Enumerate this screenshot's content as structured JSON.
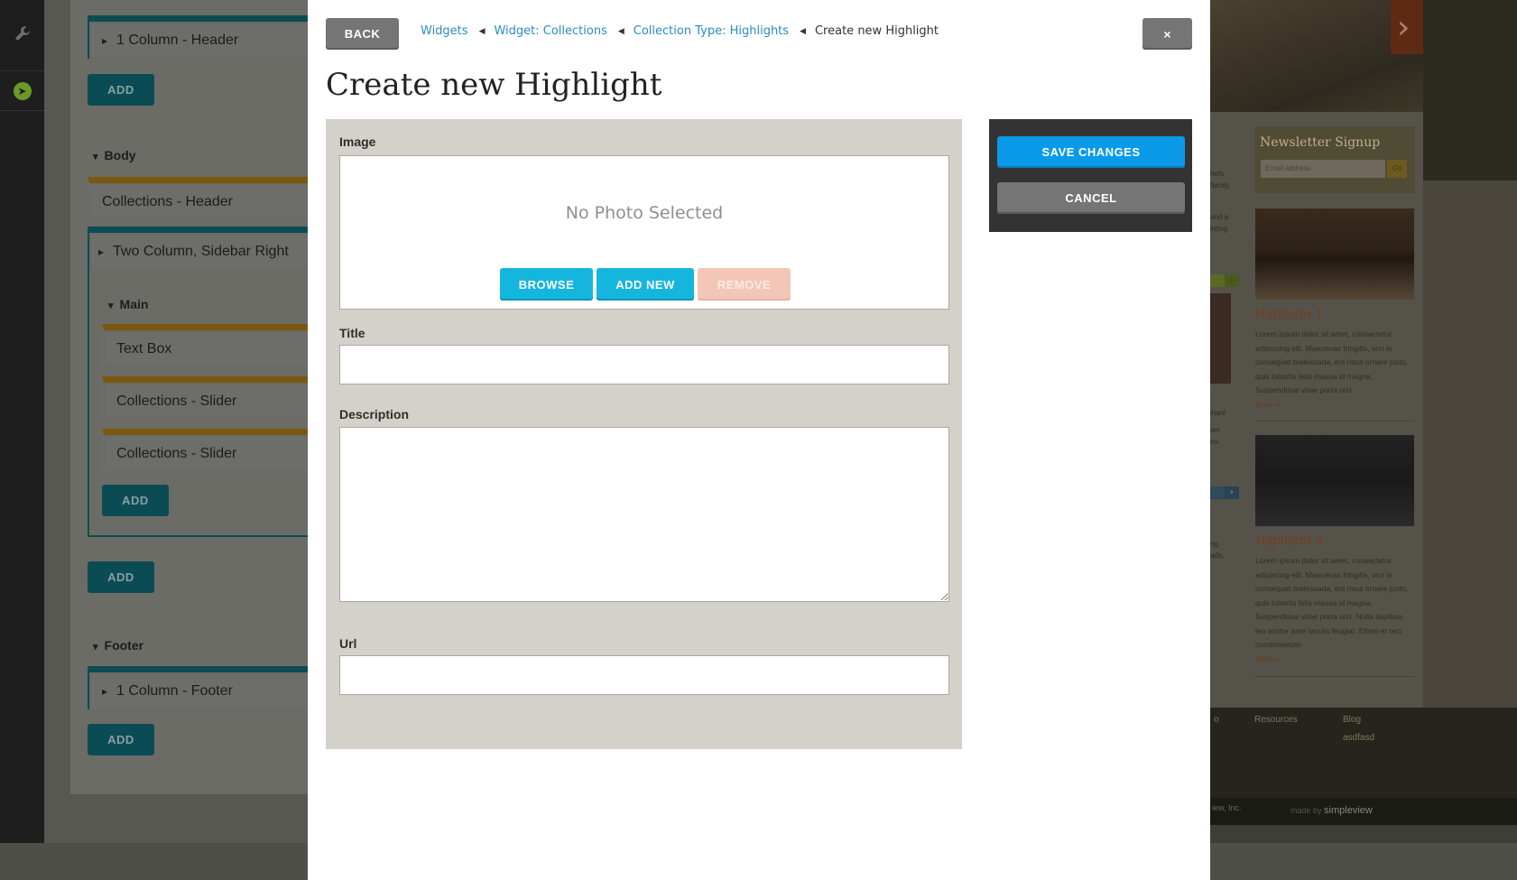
{
  "modal": {
    "back_label": "BACK",
    "close_label": "×",
    "title": "Create new Highlight",
    "breadcrumb": [
      {
        "label": "Widgets"
      },
      {
        "label": "Widget: Collections"
      },
      {
        "label": "Collection Type: Highlights"
      },
      {
        "label": "Create new Highlight"
      }
    ],
    "form": {
      "image_label": "Image",
      "no_photo_text": "No Photo Selected",
      "browse_label": "BROWSE",
      "add_new_label": "ADD NEW",
      "remove_label": "REMOVE",
      "title_label": "Title",
      "title_value": "",
      "description_label": "Description",
      "description_value": "",
      "url_label": "Url",
      "url_value": ""
    },
    "actions": {
      "save_label": "SAVE CHANGES",
      "cancel_label": "CANCEL"
    }
  },
  "builder": {
    "items": [
      {
        "label": "1 Column - Header"
      },
      {
        "label": "Collections - Header"
      },
      {
        "label": "Two Column, Sidebar Right"
      },
      {
        "label": "Text Box"
      },
      {
        "label": "Collections - Slider"
      },
      {
        "label": "Collections - Slider"
      },
      {
        "label": "1 Column - Footer"
      }
    ],
    "sections": {
      "body": "Body",
      "main": "Main",
      "footer": "Footer"
    },
    "add_label": "ADD"
  },
  "site": {
    "newsletter_title": "Newsletter Signup",
    "email_placeholder": "Email address",
    "go_label": "Go",
    "highlights": [
      {
        "title": "Highlight 1",
        "text": "Lorem ipsum dolor sit amet, consectetur adipiscing elit. Maecenas fringilla, orci in consequat malesuada, est risus ornare justo, quis lobortis felis massa id magna. Suspendisse vitae porta orci.",
        "more": "More »"
      },
      {
        "title": "Highlight 2",
        "text": "Lorem ipsum dolor sit amet, consectetur adipiscing elit. Maecenas fringilla, orci in consequat malesuada, est risus ornare justo, quis lobortis felis massa id magna. Suspendisse vitae porta orci. Nulla dapibus leo auctor ante iaculis feugiat. Etiam et orci condimentum",
        "more": "More »"
      }
    ],
    "footer_links": [
      "Resources",
      "Blog",
      "asdfasd"
    ],
    "credit_prefix": "made by",
    "credit_brand": "simpleview",
    "copyright_fragment": "iew, Inc.",
    "side_snippets": [
      "hefs family,",
      "and a inting",
      "inani",
      "am ex.",
      "ng ada,"
    ],
    "footer_fragment": "o"
  },
  "colors": {
    "accent_blue": "#14b6de",
    "save_blue": "#0a9ae8",
    "gray_button": "#757575",
    "link_blue": "#2a8cc4",
    "remove_disabled": "#f3c6b8"
  }
}
